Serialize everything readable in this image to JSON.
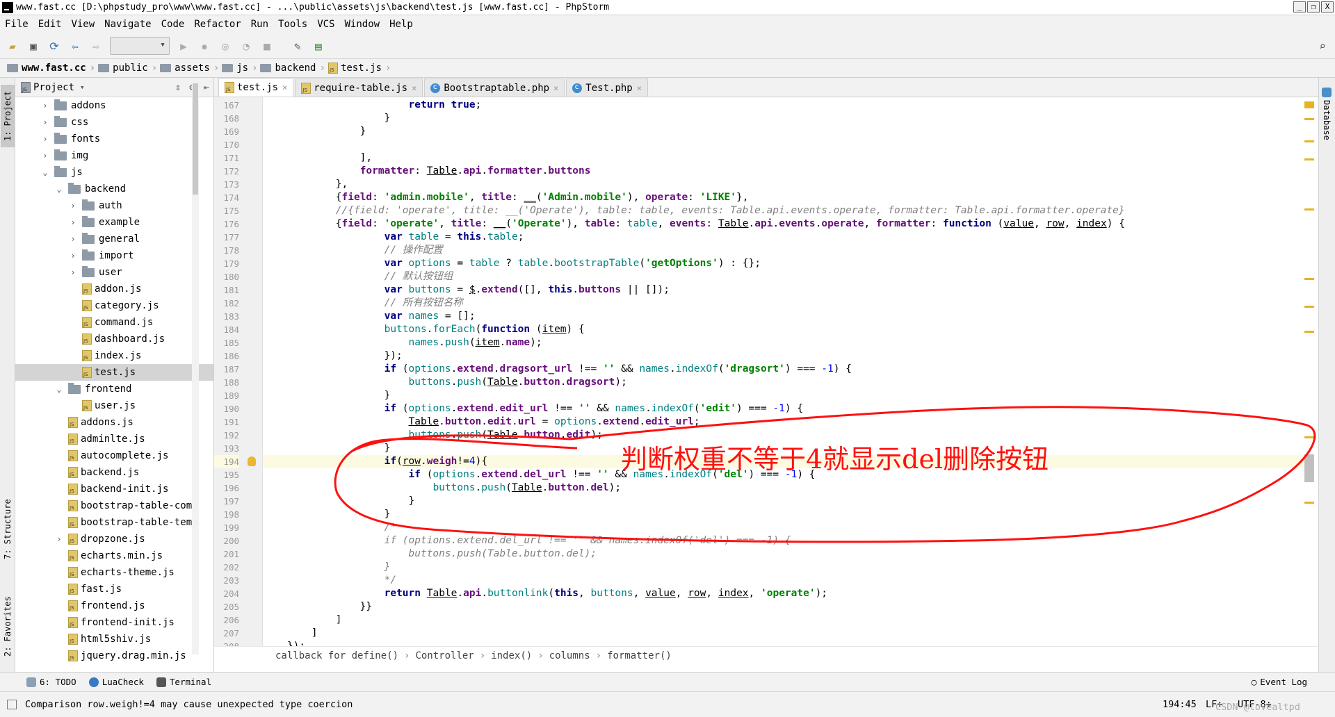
{
  "window": {
    "title": "www.fast.cc [D:\\phpstudy_pro\\www\\www.fast.cc] - ...\\public\\assets\\js\\backend\\test.js [www.fast.cc] - PhpStorm",
    "controls": [
      "_",
      "❐",
      "X"
    ]
  },
  "menu": [
    "File",
    "Edit",
    "View",
    "Navigate",
    "Code",
    "Refactor",
    "Run",
    "Tools",
    "VCS",
    "Window",
    "Help"
  ],
  "breadcrumb": [
    "www.fast.cc",
    "public",
    "assets",
    "js",
    "backend",
    "test.js"
  ],
  "project_panel": {
    "title": "Project",
    "tree": [
      {
        "label": "addons",
        "kind": "folder",
        "depth": 1,
        "arrow": "›"
      },
      {
        "label": "css",
        "kind": "folder",
        "depth": 1,
        "arrow": "›"
      },
      {
        "label": "fonts",
        "kind": "folder",
        "depth": 1,
        "arrow": "›"
      },
      {
        "label": "img",
        "kind": "folder",
        "depth": 1,
        "arrow": "›"
      },
      {
        "label": "js",
        "kind": "folder",
        "depth": 1,
        "arrow": "⌄"
      },
      {
        "label": "backend",
        "kind": "folder",
        "depth": 2,
        "arrow": "⌄"
      },
      {
        "label": "auth",
        "kind": "folder",
        "depth": 3,
        "arrow": "›"
      },
      {
        "label": "example",
        "kind": "folder",
        "depth": 3,
        "arrow": "›"
      },
      {
        "label": "general",
        "kind": "folder",
        "depth": 3,
        "arrow": "›"
      },
      {
        "label": "import",
        "kind": "folder",
        "depth": 3,
        "arrow": "›"
      },
      {
        "label": "user",
        "kind": "folder",
        "depth": 3,
        "arrow": "›"
      },
      {
        "label": "addon.js",
        "kind": "js",
        "depth": 3,
        "arrow": ""
      },
      {
        "label": "category.js",
        "kind": "js",
        "depth": 3,
        "arrow": ""
      },
      {
        "label": "command.js",
        "kind": "js",
        "depth": 3,
        "arrow": ""
      },
      {
        "label": "dashboard.js",
        "kind": "js",
        "depth": 3,
        "arrow": ""
      },
      {
        "label": "index.js",
        "kind": "js",
        "depth": 3,
        "arrow": ""
      },
      {
        "label": "test.js",
        "kind": "js",
        "depth": 3,
        "arrow": "",
        "selected": true
      },
      {
        "label": "frontend",
        "kind": "folder",
        "depth": 2,
        "arrow": "⌄"
      },
      {
        "label": "user.js",
        "kind": "js",
        "depth": 3,
        "arrow": ""
      },
      {
        "label": "addons.js",
        "kind": "js",
        "depth": 2,
        "arrow": ""
      },
      {
        "label": "adminlte.js",
        "kind": "js",
        "depth": 2,
        "arrow": ""
      },
      {
        "label": "autocomplete.js",
        "kind": "js",
        "depth": 2,
        "arrow": ""
      },
      {
        "label": "backend.js",
        "kind": "js",
        "depth": 2,
        "arrow": ""
      },
      {
        "label": "backend-init.js",
        "kind": "js",
        "depth": 2,
        "arrow": ""
      },
      {
        "label": "bootstrap-table-com",
        "kind": "js",
        "depth": 2,
        "arrow": ""
      },
      {
        "label": "bootstrap-table-tem",
        "kind": "js",
        "depth": 2,
        "arrow": ""
      },
      {
        "label": "dropzone.js",
        "kind": "js",
        "depth": 2,
        "arrow": "›"
      },
      {
        "label": "echarts.min.js",
        "kind": "js",
        "depth": 2,
        "arrow": ""
      },
      {
        "label": "echarts-theme.js",
        "kind": "js",
        "depth": 2,
        "arrow": ""
      },
      {
        "label": "fast.js",
        "kind": "js",
        "depth": 2,
        "arrow": ""
      },
      {
        "label": "frontend.js",
        "kind": "js",
        "depth": 2,
        "arrow": ""
      },
      {
        "label": "frontend-init.js",
        "kind": "js",
        "depth": 2,
        "arrow": ""
      },
      {
        "label": "html5shiv.js",
        "kind": "js",
        "depth": 2,
        "arrow": ""
      },
      {
        "label": "jquery.drag.min.js",
        "kind": "js",
        "depth": 2,
        "arrow": ""
      }
    ]
  },
  "left_strip": [
    "1: Project",
    "7: Structure",
    "2: Favorites"
  ],
  "right_strip": [
    "Database"
  ],
  "tabs": [
    {
      "label": "test.js",
      "icon": "js",
      "active": true
    },
    {
      "label": "require-table.js",
      "icon": "js",
      "active": false
    },
    {
      "label": "Bootstraptable.php",
      "icon": "class",
      "active": false
    },
    {
      "label": "Test.php",
      "icon": "class",
      "active": false
    }
  ],
  "code_lines": [
    {
      "n": "167",
      "html": "                        <span class=\"k\">return true</span>;"
    },
    {
      "n": "168",
      "html": "                    }"
    },
    {
      "n": "169",
      "html": "                }"
    },
    {
      "n": "170",
      "html": ""
    },
    {
      "n": "171",
      "html": "                ],"
    },
    {
      "n": "172",
      "html": "                <span class=\"p\">formatter</span>: <span class=\"u\">Table</span>.<span class=\"p\">api</span>.<span class=\"p\">formatter</span>.<span class=\"p\">buttons</span>"
    },
    {
      "n": "173",
      "html": "            },"
    },
    {
      "n": "174",
      "html": "            {<span class=\"p\">field</span>: <span class=\"s\">'admin.mobile'</span>, <span class=\"p\">title</span>: <span class=\"u\">__</span>(<span class=\"s\">'Admin.mobile'</span>), <span class=\"p\">operate</span>: <span class=\"s\">'LIKE'</span>},"
    },
    {
      "n": "175",
      "html": "            <span class=\"c\">//{field: 'operate', title: __('Operate'), table: table, events: Table.api.events.operate, formatter: Table.api.formatter.operate}</span>"
    },
    {
      "n": "176",
      "html": "            {<span class=\"p\">field</span>: <span class=\"s\">'operate'</span>, <span class=\"p\">title</span>: <span class=\"u\">__</span>(<span class=\"s\">'Operate'</span>), <span class=\"p\">table</span>: <span class=\"fn\">table</span>, <span class=\"p\">events</span>: <span class=\"u\">Table</span>.<span class=\"p\">api</span>.<span class=\"p\">events</span>.<span class=\"p\">operate</span>, <span class=\"p\">formatter</span>: <span class=\"k\">function</span> (<span class=\"u\">value</span>, <span class=\"u\">row</span>, <span class=\"u\">index</span>) {"
    },
    {
      "n": "177",
      "html": "                    <span class=\"k\">var</span> <span class=\"fn\">table</span> = <span class=\"k\">this</span>.<span class=\"fn\">table</span>;"
    },
    {
      "n": "178",
      "html": "                    <span class=\"c\">// 操作配置</span>"
    },
    {
      "n": "179",
      "html": "                    <span class=\"k\">var</span> <span class=\"fn\">options</span> = <span class=\"fn\">table</span> ? <span class=\"fn\">table</span>.<span class=\"fn\">bootstrapTable</span>(<span class=\"s\">'getOptions'</span>) : {};"
    },
    {
      "n": "180",
      "html": "                    <span class=\"c\">// 默认按钮组</span>"
    },
    {
      "n": "181",
      "html": "                    <span class=\"k\">var</span> <span class=\"fn\">buttons</span> = <span class=\"u\">$</span>.<span class=\"p\">extend</span>([], <span class=\"k\">this</span>.<span class=\"p\">buttons</span> || []);"
    },
    {
      "n": "182",
      "html": "                    <span class=\"c\">// 所有按钮名称</span>"
    },
    {
      "n": "183",
      "html": "                    <span class=\"k\">var</span> <span class=\"fn\">names</span> = [];"
    },
    {
      "n": "184",
      "html": "                    <span class=\"fn\">buttons</span>.<span class=\"fn\">forEach</span>(<span class=\"k\">function</span> (<span class=\"u\">item</span>) {"
    },
    {
      "n": "185",
      "html": "                        <span class=\"fn\">names</span>.<span class=\"fn\">push</span>(<span class=\"u\">item</span>.<span class=\"p\">name</span>);"
    },
    {
      "n": "186",
      "html": "                    });"
    },
    {
      "n": "187",
      "html": "                    <span class=\"k\">if</span> (<span class=\"fn\">options</span>.<span class=\"p\">extend</span>.<span class=\"p\">dragsort_url</span> !== <span class=\"s\">''</span> &amp;&amp; <span class=\"fn\">names</span>.<span class=\"fn\">indexOf</span>(<span class=\"s\">'dragsort'</span>) === <span class=\"n\">-1</span>) {"
    },
    {
      "n": "188",
      "html": "                        <span class=\"fn\">buttons</span>.<span class=\"fn\">push</span>(<span class=\"u\">Table</span>.<span class=\"p\">button</span>.<span class=\"p\">dragsort</span>);"
    },
    {
      "n": "189",
      "html": "                    }"
    },
    {
      "n": "190",
      "html": "                    <span class=\"k\">if</span> (<span class=\"fn\">options</span>.<span class=\"p\">extend</span>.<span class=\"p\">edit_url</span> !== <span class=\"s\">''</span> &amp;&amp; <span class=\"fn\">names</span>.<span class=\"fn\">indexOf</span>(<span class=\"s\">'edit'</span>) === <span class=\"n\">-1</span>) {"
    },
    {
      "n": "191",
      "html": "                        <span class=\"u\">Table</span>.<span class=\"p\">button</span>.<span class=\"p\">edit</span>.<span class=\"p\">url</span> = <span class=\"fn\">options</span>.<span class=\"p\">extend</span>.<span class=\"p\">edit_url</span>;"
    },
    {
      "n": "192",
      "html": "                        <span class=\"fn\">buttons</span>.<span class=\"fn\">push</span>(<span class=\"u\">Table</span>.<span class=\"p\">button</span>.<span class=\"p\">edit</span>);"
    },
    {
      "n": "193",
      "html": "                    }"
    },
    {
      "n": "194",
      "html": "                    <span class=\"k\">if</span>(<span class=\"u\">row</span>.<span class=\"p\">weigh</span>!=<span class=\"n\">4</span>){",
      "cur": true
    },
    {
      "n": "195",
      "html": "                        <span class=\"k\">if</span> (<span class=\"fn\">options</span>.<span class=\"p\">extend</span>.<span class=\"p\">del_url</span> !== <span class=\"s\">''</span> &amp;&amp; <span class=\"fn\">names</span>.<span class=\"fn\">indexOf</span>(<span class=\"s\">'del'</span>) === <span class=\"n\">-1</span>) {"
    },
    {
      "n": "196",
      "html": "                            <span class=\"fn\">buttons</span>.<span class=\"fn\">push</span>(<span class=\"u\">Table</span>.<span class=\"p\">button</span>.<span class=\"p\">del</span>);"
    },
    {
      "n": "197",
      "html": "                        }"
    },
    {
      "n": "198",
      "html": "                    }"
    },
    {
      "n": "199",
      "html": "                    <span class=\"c\">/*</span>"
    },
    {
      "n": "200",
      "html": "                    <span class=\"c\">if (options.extend.del_url !== '' &amp;&amp; names.indexOf('del') === -1) {</span>"
    },
    {
      "n": "201",
      "html": "                        <span class=\"c\">buttons.push(Table.button.del);</span>"
    },
    {
      "n": "202",
      "html": "                    <span class=\"c\">}</span>"
    },
    {
      "n": "203",
      "html": "                    <span class=\"c\">*/</span>"
    },
    {
      "n": "204",
      "html": "                    <span class=\"k\">return</span> <span class=\"u\">Table</span>.<span class=\"p\">api</span>.<span class=\"fn\">buttonlink</span>(<span class=\"k\">this</span>, <span class=\"fn\">buttons</span>, <span class=\"u\">value</span>, <span class=\"u\">row</span>, <span class=\"u\">index</span>, <span class=\"s\">'operate'</span>);"
    },
    {
      "n": "205",
      "html": "                }}"
    },
    {
      "n": "206",
      "html": "            ]"
    },
    {
      "n": "207",
      "html": "        ]"
    },
    {
      "n": "208",
      "html": "    });"
    }
  ],
  "structure_path": [
    "callback for define()",
    "Controller",
    "index()",
    "columns",
    "formatter()"
  ],
  "bottom_tools": [
    "6: TODO",
    "LuaCheck",
    "Terminal"
  ],
  "event_log": "Event Log",
  "status": {
    "message": "Comparison row.weigh!=4 may cause unexpected type coercion",
    "position": "194:45",
    "line_sep": "LF÷",
    "encoding": "UTF-8÷",
    "watermark": "CSDN @lovealtpd"
  },
  "annotation": {
    "text": "判断权重不等于4就显示del删除按钮",
    "color": "#ff1010"
  }
}
